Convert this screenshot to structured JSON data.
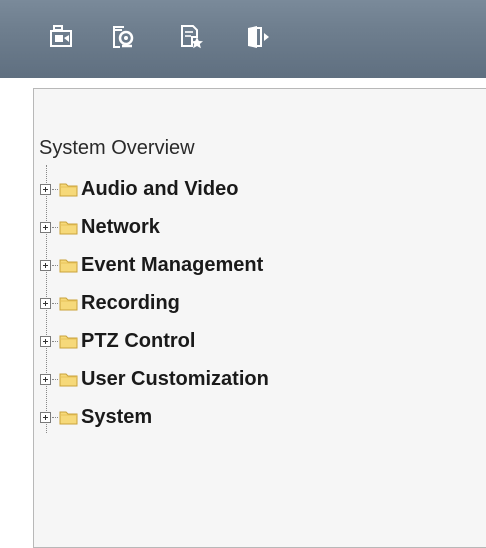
{
  "toolbar": {
    "buttons": [
      {
        "name": "live-view",
        "icon": "camera-monitor-icon"
      },
      {
        "name": "playback",
        "icon": "search-recording-icon"
      },
      {
        "name": "settings",
        "icon": "document-star-icon"
      },
      {
        "name": "logout",
        "icon": "exit-door-icon"
      }
    ]
  },
  "sidebar": {
    "title": "System Overview",
    "items": [
      {
        "label": "Audio and Video"
      },
      {
        "label": "Network"
      },
      {
        "label": "Event Management"
      },
      {
        "label": "Recording"
      },
      {
        "label": "PTZ Control"
      },
      {
        "label": "User Customization"
      },
      {
        "label": "System"
      }
    ]
  },
  "colors": {
    "toolbar_bg": "#6f7f8f",
    "icon_white": "#ffffff",
    "folder_fill": "#f6d97a",
    "folder_stroke": "#c9a23a",
    "panel_bg": "#f6f6f6"
  }
}
